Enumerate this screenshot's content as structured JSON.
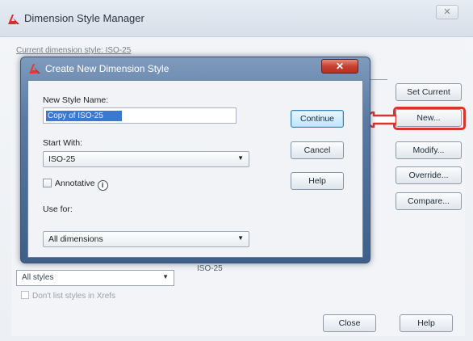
{
  "manager": {
    "title": "Dimension Style Manager",
    "close_glyph": "✕",
    "current_style_label": "Current dimension style: ISO-25",
    "buttons": {
      "set_current": "Set Current",
      "new": "New...",
      "modify": "Modify...",
      "override": "Override...",
      "compare": "Compare..."
    },
    "list_filter": "All styles",
    "dont_list_xrefs": "Don't list styles in Xrefs",
    "preview_caption": "ISO-25",
    "close_button": "Close",
    "help_button": "Help"
  },
  "dialog": {
    "title": "Create New Dimension Style",
    "close_glyph": "✕",
    "new_style_name_label": "New Style Name:",
    "new_style_name_value": "Copy of ISO-25",
    "start_with_label": "Start With:",
    "start_with_value": "ISO-25",
    "annotative_label": "Annotative",
    "info_glyph": "i",
    "use_for_label": "Use for:",
    "use_for_value": "All dimensions",
    "buttons": {
      "continue": "Continue",
      "cancel": "Cancel",
      "help": "Help"
    }
  },
  "colors": {
    "highlight": "#d8342d",
    "dialog_frame": "#5a7aa2",
    "selection": "#3b78cf"
  }
}
